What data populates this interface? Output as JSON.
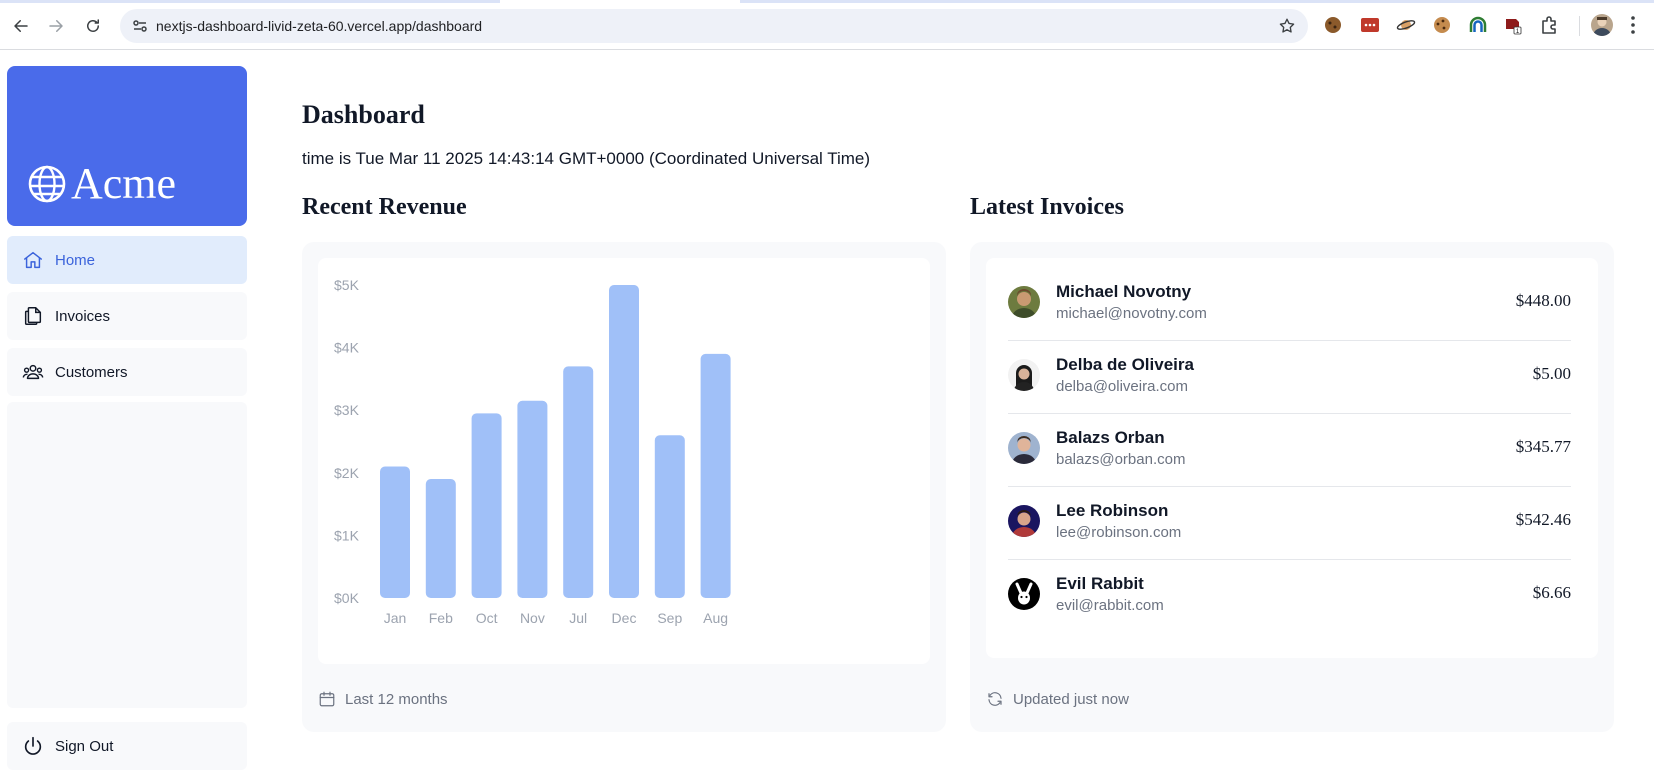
{
  "browser": {
    "url": "nextjs-dashboard-livid-zeta-60.vercel.app/dashboard"
  },
  "sidebar": {
    "logo_text": "Acme",
    "brand_color": "#4a6bea",
    "items": [
      {
        "label": "Home",
        "icon": "home-icon",
        "active": true
      },
      {
        "label": "Invoices",
        "icon": "document-duplicate-icon",
        "active": false
      },
      {
        "label": "Customers",
        "icon": "user-group-icon",
        "active": false
      }
    ],
    "sign_out_label": "Sign Out"
  },
  "main": {
    "title": "Dashboard",
    "time_text": "time is Tue Mar 11 2025 14:43:14 GMT+0000 (Coordinated Universal Time)",
    "revenue_title": "Recent Revenue",
    "revenue_footer": "Last 12 months",
    "invoices_title": "Latest Invoices",
    "invoices_footer": "Updated just now"
  },
  "chart_data": {
    "type": "bar",
    "categories": [
      "Jan",
      "Feb",
      "Oct",
      "Nov",
      "Jul",
      "Dec",
      "Sep",
      "Aug"
    ],
    "values": [
      2100,
      1900,
      2950,
      3150,
      3700,
      5000,
      2600,
      3900
    ],
    "y_ticks": [
      "$5K",
      "$4K",
      "$3K",
      "$2K",
      "$1K",
      "$0K"
    ],
    "ylim": [
      0,
      5000
    ],
    "bar_color": "#a0c0f8",
    "grid": false
  },
  "invoices": [
    {
      "name": "Michael Novotny",
      "email": "michael@novotny.com",
      "amount": "$448.00",
      "avatar": "avatar-michael"
    },
    {
      "name": "Delba de Oliveira",
      "email": "delba@oliveira.com",
      "amount": "$5.00",
      "avatar": "avatar-delba"
    },
    {
      "name": "Balazs Orban",
      "email": "balazs@orban.com",
      "amount": "$345.77",
      "avatar": "avatar-balazs"
    },
    {
      "name": "Lee Robinson",
      "email": "lee@robinson.com",
      "amount": "$542.46",
      "avatar": "avatar-lee"
    },
    {
      "name": "Evil Rabbit",
      "email": "evil@rabbit.com",
      "amount": "$6.66",
      "avatar": "avatar-evil-rabbit"
    }
  ]
}
